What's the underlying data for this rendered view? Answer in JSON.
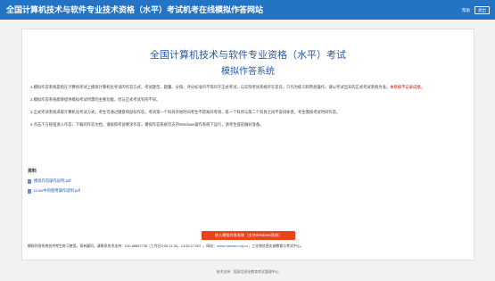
{
  "header": {
    "title": "全国计算机技术与软件专业技术资格（水平）考试机考在线模拟作答网站",
    "help_label": "帮助",
    "logout_label": "退出"
  },
  "main": {
    "title": "全国计算机技术与软件专业资格（水平）考试",
    "subtitle": "模拟作答系统",
    "notes": [
      {
        "text": "1.模拟作答系统是指在计算机考试上模拟计算机化考试的作答方式，考试题型、题量、分值、评分标准均不等同于正式考试，与实际考试系统存在差异，只作为练习和熟悉操作，请以考试当天的正式考试系统为准。",
        "warn": "本系统不记录成绩。"
      },
      {
        "text": "2.模拟作答系统能够提供模拟考试所需的主要功能，但与正式考试有所不同。",
        "warn": ""
      },
      {
        "text": "3.正式考试系统采取计算机化考试方式，考生可通过键盘和鼠标作答。考试第一个科目开始时间考生不得离开考场，第一个科目与第二个科目之间不安排休息，考生需按考试时间作答。",
        "warn": ""
      },
      {
        "text": "4.点击下方按钮进入作答，下载的作答文档，请按照考试要求作答。模拟作答系统仅支持Windows操作系统下运行，请考生提前做好准备。",
        "warn": ""
      }
    ],
    "resources_label": "资料",
    "files": [
      {
        "name": "模拟作答操作说明.pdf"
      },
      {
        "name": "Linux中的使用操作说明.pdf"
      }
    ],
    "enter_button": "进入模拟作答系统（支持Windows系统）",
    "footnote": "模拟作答系统仅供考生练习使用。如有疑问，请联系技术支持：010-88657735（工作日9:00-11:30，13:30-17:00）。网站：",
    "footnote_link": "www.ruankao.org.cn",
    "footnote_tail": "，工业和信息化部教育与考试中心。"
  },
  "footer": {
    "copyright": "技术支持：国家信息化教育考试管理中心"
  }
}
